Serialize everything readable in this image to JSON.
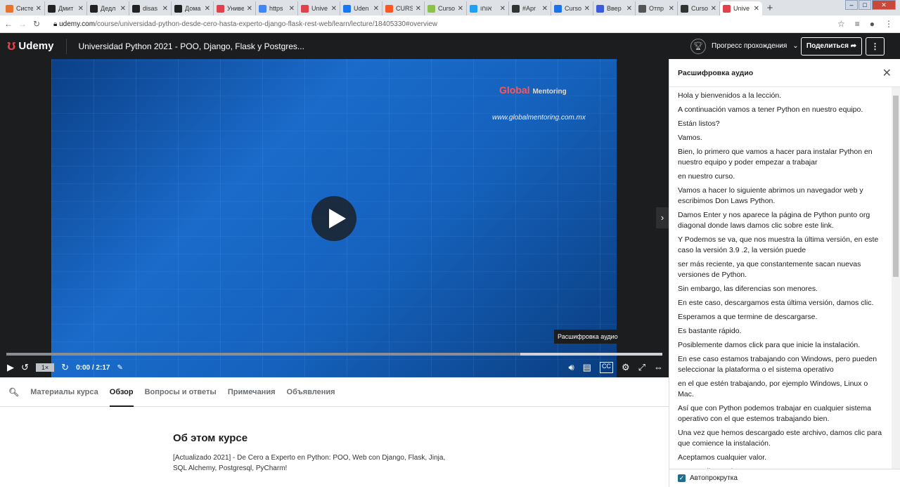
{
  "browser": {
    "tabs": [
      {
        "label": "Систе",
        "color": "#e8732c"
      },
      {
        "label": "Дмит",
        "color": "#222"
      },
      {
        "label": "Дедл",
        "color": "#222"
      },
      {
        "label": "disas",
        "color": "#222"
      },
      {
        "label": "Дома",
        "color": "#222"
      },
      {
        "label": "Униве",
        "color": "#e0414a"
      },
      {
        "label": "https",
        "color": "#4285f4"
      },
      {
        "label": "Unive",
        "color": "#e0414a"
      },
      {
        "label": "Uden",
        "color": "#1877f2"
      },
      {
        "label": "CURS",
        "color": "#ff5722"
      },
      {
        "label": "Curso",
        "color": "#8bc34a"
      },
      {
        "label": "אוחו",
        "color": "#1da1f2"
      },
      {
        "label": "#Apr",
        "color": "#333"
      },
      {
        "label": "Curso",
        "color": "#1a73e8"
      },
      {
        "label": "Ввер",
        "color": "#3b5bdb"
      },
      {
        "label": "Отпр",
        "color": "#555"
      },
      {
        "label": "Curso",
        "color": "#333"
      },
      {
        "label": "Unive",
        "color": "#e0414a",
        "active": true
      }
    ],
    "url_host": "udemy.com",
    "url_path": "/course/universidad-python-desde-cero-hasta-experto-django-flask-rest-web/learn/lecture/18405330#overview"
  },
  "header": {
    "logo": "Udemy",
    "course_title": "Universidad Python 2021 - POO, Django, Flask y Postgres...",
    "progress_label": "Прогресс прохождения",
    "share_label": "Поделиться"
  },
  "video": {
    "watermark_url": "www.globalmentoring.com.mx",
    "watermark_brand": "Global",
    "watermark_sub": "Mentoring",
    "tooltip": "Расшифровка аудио",
    "speed": "1×",
    "time": "0:00 / 2:17",
    "progress": 0.0,
    "buffered": 0.78
  },
  "tabs": {
    "items": [
      "Материалы курса",
      "Обзор",
      "Вопросы и ответы",
      "Примечания",
      "Объявления"
    ],
    "active": 1
  },
  "about": {
    "heading": "Об этом курсе",
    "description": "[Actualizado 2021] - De Cero a Experto en Python: POO, Web con Django, Flask, Jinja, SQL Alchemy, Postgresql, PyCharm!"
  },
  "transcript": {
    "title": "Расшифровка аудио",
    "autoscroll": "Автопрокрутка",
    "cues": [
      "Hola y bienvenidos a la lección.",
      "A continuación vamos a tener Python en nuestro equipo.",
      "Están listos?",
      "Vamos.",
      "Bien, lo primero que vamos a hacer para instalar Python en nuestro equipo y poder empezar a trabajar",
      "en nuestro curso.",
      "Vamos a hacer lo siguiente abrimos un navegador web y escribimos Don Laws Python.",
      "Damos Enter y nos aparece la página de Python punto org diagonal donde laws damos clic sobre este link.",
      "Y Podemos se va, que nos muestra la última versión, en este caso la versión 3.9 .2, la versión puede",
      "ser más reciente, ya que constantemente sacan nuevas versiones de Python.",
      "Sin embargo, las diferencias son menores.",
      "En este caso, descargamos esta última versión, damos clic.",
      "Esperamos a que termine de descargarse.",
      "Es bastante rápido.",
      "Posiblemente damos click para que inicie la instalación.",
      "En ese caso estamos trabajando con Windows, pero pueden seleccionar la plataforma o el sistema operativo",
      "en el que estén trabajando, por ejemplo Windows, Linux o Mac.",
      "Así que con Python podemos trabajar en cualquier sistema operativo con el que estemos trabajando bien.",
      "Una vez que hemos descargado este archivo, damos clic para que comience la instalación.",
      "Aceptamos cualquier valor.",
      "Damos clic en Ejecutar."
    ]
  }
}
